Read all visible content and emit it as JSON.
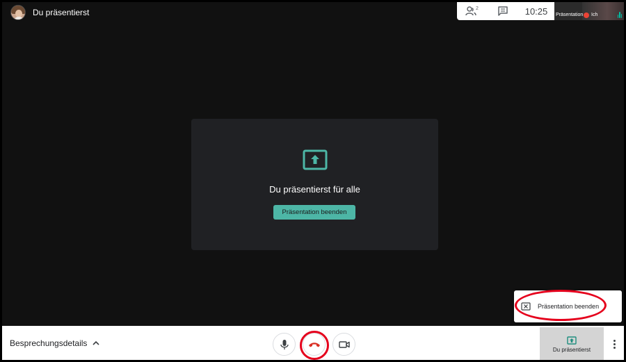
{
  "presenter": {
    "name": "Du präsentierst",
    "avatar_icon": "avatar-photo"
  },
  "top_right": {
    "participants_icon": "people-icon",
    "participants_count": "2",
    "chat_icon": "chat-icon",
    "clock": "10:25",
    "self_view": {
      "presenting_label": "Präsentation",
      "self_label": "Ich"
    }
  },
  "center_card": {
    "icon": "present-screen-icon",
    "title": "Du präsentierst für alle",
    "stop_button_label": "Präsentation beenden"
  },
  "popup": {
    "item_icon": "stop-present-icon",
    "item_label": "Präsentation beenden"
  },
  "bottom_bar": {
    "details_label": "Besprechungsdetails",
    "details_icon": "chevron-up-icon",
    "mic_icon": "mic-icon",
    "hangup_icon": "hangup-icon",
    "camera_icon": "camera-icon",
    "presenting_tile_label": "Du präsentierst",
    "more_icon": "more-vert-icon"
  },
  "colors": {
    "accent": "#4db6a6",
    "hangup": "#d93025",
    "annotation_red": "#e5001c",
    "stage_bg": "#111111",
    "card_bg": "#202124"
  }
}
